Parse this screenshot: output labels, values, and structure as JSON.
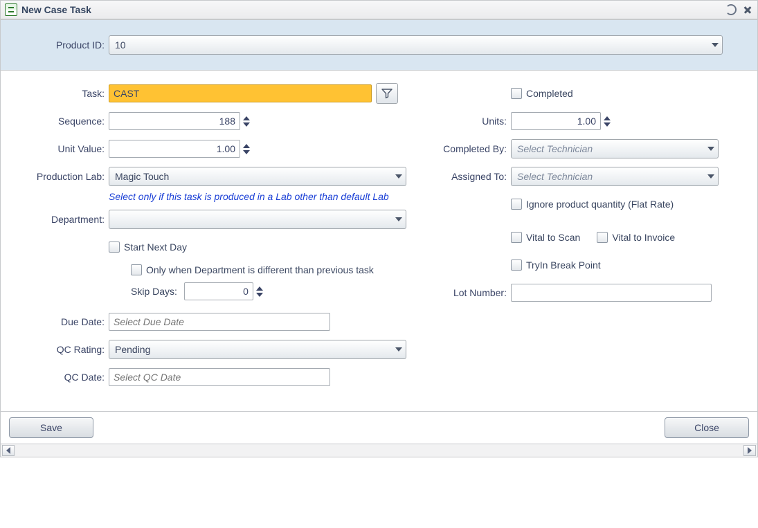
{
  "window": {
    "title": "New Case Task"
  },
  "productId": {
    "label": "Product ID:",
    "value": "10"
  },
  "left": {
    "task": {
      "label": "Task:",
      "value": "CAST"
    },
    "sequence": {
      "label": "Sequence:",
      "value": "188"
    },
    "unitValue": {
      "label": "Unit Value:",
      "value": "1.00"
    },
    "prodLab": {
      "label": "Production Lab:",
      "value": "Magic Touch",
      "help": "Select only if this task is produced in a Lab other than default Lab"
    },
    "department": {
      "label": "Department:",
      "value": ""
    },
    "startNextDay": {
      "label": "Start Next Day"
    },
    "onlyDiffDept": {
      "label": "Only when Department is different than previous task"
    },
    "skipDays": {
      "label": "Skip Days:",
      "value": "0"
    },
    "dueDate": {
      "label": "Due Date:",
      "placeholder": "Select Due Date"
    },
    "qcRating": {
      "label": "QC Rating:",
      "value": "Pending"
    },
    "qcDate": {
      "label": "QC Date:",
      "placeholder": "Select QC Date"
    }
  },
  "right": {
    "completed": {
      "label": "Completed"
    },
    "units": {
      "label": "Units:",
      "value": "1.00"
    },
    "completedBy": {
      "label": "Completed By:",
      "placeholder": "Select Technician"
    },
    "assignedTo": {
      "label": "Assigned To:",
      "placeholder": "Select Technician"
    },
    "ignoreQty": {
      "label": "Ignore product quantity (Flat Rate)"
    },
    "vitalScan": {
      "label": "Vital to Scan"
    },
    "vitalInvoice": {
      "label": "Vital to Invoice"
    },
    "tryinBreak": {
      "label": "TryIn Break Point"
    },
    "lotNumber": {
      "label": "Lot Number:"
    }
  },
  "footer": {
    "save": "Save",
    "close": "Close"
  }
}
